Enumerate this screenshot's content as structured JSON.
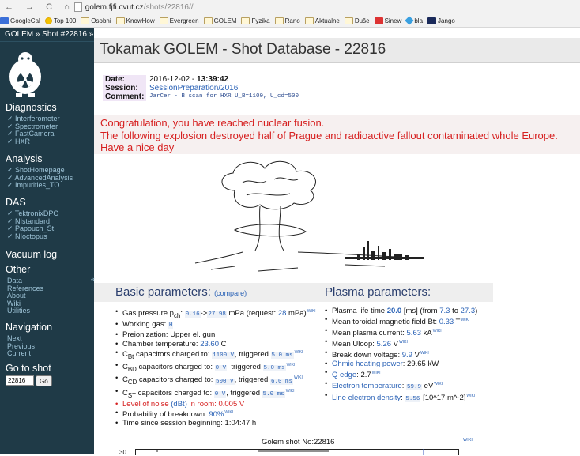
{
  "browser": {
    "nav": "← → C ⌂",
    "host": "golem.fjfi.cvut.cz",
    "path": "/shots/22816//",
    "bookmarks": [
      {
        "label": "GoogleCal",
        "icon": "g"
      },
      {
        "label": "Top 100",
        "icon": "y"
      },
      {
        "label": "Osobni",
        "icon": "f"
      },
      {
        "label": "KnowHow",
        "icon": "f"
      },
      {
        "label": "Evergreen",
        "icon": "f"
      },
      {
        "label": "GOLEM",
        "icon": "f"
      },
      {
        "label": "Fyzika",
        "icon": "f"
      },
      {
        "label": "Rano",
        "icon": "f"
      },
      {
        "label": "Aktualne",
        "icon": "f"
      },
      {
        "label": "Duše",
        "icon": "f"
      },
      {
        "label": "Sinew",
        "icon": "r"
      },
      {
        "label": "bla",
        "icon": "b"
      },
      {
        "label": "Jango",
        "icon": "k"
      }
    ]
  },
  "sidebar": {
    "breadcrumb": "GOLEM » Shot #22816 »",
    "sections": [
      {
        "title": "Diagnostics",
        "items": [
          "✓ Interferometer",
          "✓ Spectrometer",
          "✓ FastCamera",
          "✓ HXR"
        ]
      },
      {
        "title": "Analysis",
        "items": [
          "✓ ShotHomepage",
          "✓ AdvancedAnalysis",
          "✓ Impurities_TO"
        ]
      },
      {
        "title": "DAS",
        "items": [
          "✓ TektronixDPO",
          "✓ NIstandard",
          "✓ Papouch_St",
          "✓ NIoctopus"
        ]
      },
      {
        "title": "Vacuum log",
        "items": []
      },
      {
        "title": "Other",
        "items": [
          "Data",
          "References",
          "About",
          "Wiki",
          "Utilities"
        ]
      },
      {
        "title": "Navigation",
        "items": [
          "Next",
          "Previous",
          "Current"
        ]
      }
    ],
    "collapse": "«",
    "goto_title": "Go to shot",
    "goto_value": "22816",
    "goto_button": "Go"
  },
  "main": {
    "title": "Tokamak GOLEM - Shot Database - 22816",
    "info": {
      "date_label": "Date:",
      "date_value": "2016-12-02 - ",
      "time_value": "13:39:42",
      "session_label": "Session:",
      "session_value": "SessionPreparation/2016",
      "comment_label": "Comment:",
      "comment_value": "JarCer - B scan for HXR U_B=1100, U_cd=500"
    },
    "message": [
      "Congratulation, you have reached nuclear fusion.",
      "The following explosion destroyed half of Prague and radioactive fallout contaminated whole Europe.",
      "Have a nice day"
    ],
    "basic_title": "Basic parameters:",
    "compare_link": "(compare)",
    "plasma_title": "Plasma parameters:",
    "basic": {
      "gas_pre": "Gas pressure p",
      "gas_sub": "ch",
      "gas_sep": ": ",
      "gas_v1": "0.16",
      "gas_arrow": "->",
      "gas_v2": "27.98",
      "gas_mid": " mPa (request: ",
      "gas_req": "28",
      "gas_post": " mPa)",
      "working_gas": "Working gas: ",
      "working_gas_val": "H",
      "preionization": "Preionization: Upper el. gun",
      "chamber": "Chamber temperature: ",
      "chamber_val": "23.60",
      "chamber_unit": " C",
      "cbt_pre": "C",
      "cbt_sub": "Bt",
      "cbt_mid": " capacitors charged to: ",
      "cbt_val": "1100 V",
      "trig": ", triggered ",
      "cbt_trig": "5.0 ms",
      "cbd_sub": "BD",
      "cbd_val": "0 V",
      "cbd_trig": "5.0 ms",
      "ccd_sub": "CD",
      "ccd_val": "500 V",
      "ccd_trig": "6.0 ms",
      "cst_sub": "ST",
      "cst_val": "0 V",
      "cst_trig": "5.0 ms",
      "noise_pre": "Level of noise ",
      "noise_link": "(dBt)",
      "noise_post": " in room: 0.005 V",
      "prob": "Probability of breakdown: ",
      "prob_val": "90%",
      "time_since": "Time since session beginning: 1:04:47 h"
    },
    "plasma": {
      "life_pre": "Plasma life time ",
      "life_val": "20.0",
      "life_mid": " [ms] (from ",
      "life_from": "7.3",
      "life_to_word": " to ",
      "life_to": "27.3",
      "life_post": ")",
      "bt": "Mean toroidal magnetic field Bt: ",
      "bt_val": "0.33",
      "bt_unit": " T",
      "ip": "Mean plasma current: ",
      "ip_val": "5.63",
      "ip_unit": " kA",
      "uloop": "Mean Uloop: ",
      "uloop_val": "5.26",
      "uloop_unit": " V",
      "bd": "Break down voltage: ",
      "bd_val": "9.9",
      "bd_unit": " V",
      "ohm_link": "Ohmic heating power",
      "ohm_post": ": 29.65 kW",
      "q_link": "Q edge",
      "q_post": ": 2.7",
      "te_link": "Electron temperature",
      "te_sep": ": ",
      "te_val": "59.9",
      "te_unit": " eV",
      "ne_link": "Line electron density",
      "ne_sep": ": ",
      "ne_val": "5.56",
      "ne_unit": " [10^17.m^-2]"
    },
    "wiki": "WIKI",
    "graph_title": "Golem shot No:22816",
    "graph_y_tick": "30"
  }
}
